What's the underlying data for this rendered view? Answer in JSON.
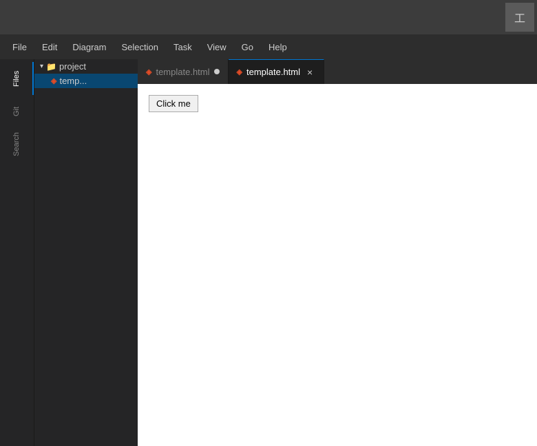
{
  "topbar": {
    "tool_button_label": "工"
  },
  "menu": {
    "items": [
      {
        "id": "file",
        "label": "File"
      },
      {
        "id": "edit",
        "label": "Edit"
      },
      {
        "id": "diagram",
        "label": "Diagram"
      },
      {
        "id": "selection",
        "label": "Selection"
      },
      {
        "id": "task",
        "label": "Task"
      },
      {
        "id": "view",
        "label": "View"
      },
      {
        "id": "go",
        "label": "Go"
      },
      {
        "id": "help",
        "label": "Help"
      }
    ]
  },
  "activity_bar": {
    "items": [
      {
        "id": "files",
        "label": "Files",
        "active": true
      },
      {
        "id": "git",
        "label": "Git",
        "active": false
      },
      {
        "id": "search",
        "label": "Search",
        "active": false
      }
    ]
  },
  "sidebar": {
    "folder_name": "project",
    "file_name": "temp..."
  },
  "tabs": {
    "items": [
      {
        "id": "tab1",
        "label": "template.html",
        "active": false,
        "has_dot": true,
        "show_close": false
      },
      {
        "id": "tab2",
        "label": "template.html",
        "active": true,
        "has_dot": false,
        "show_close": true
      }
    ]
  },
  "preview": {
    "button_label": "Click me"
  }
}
